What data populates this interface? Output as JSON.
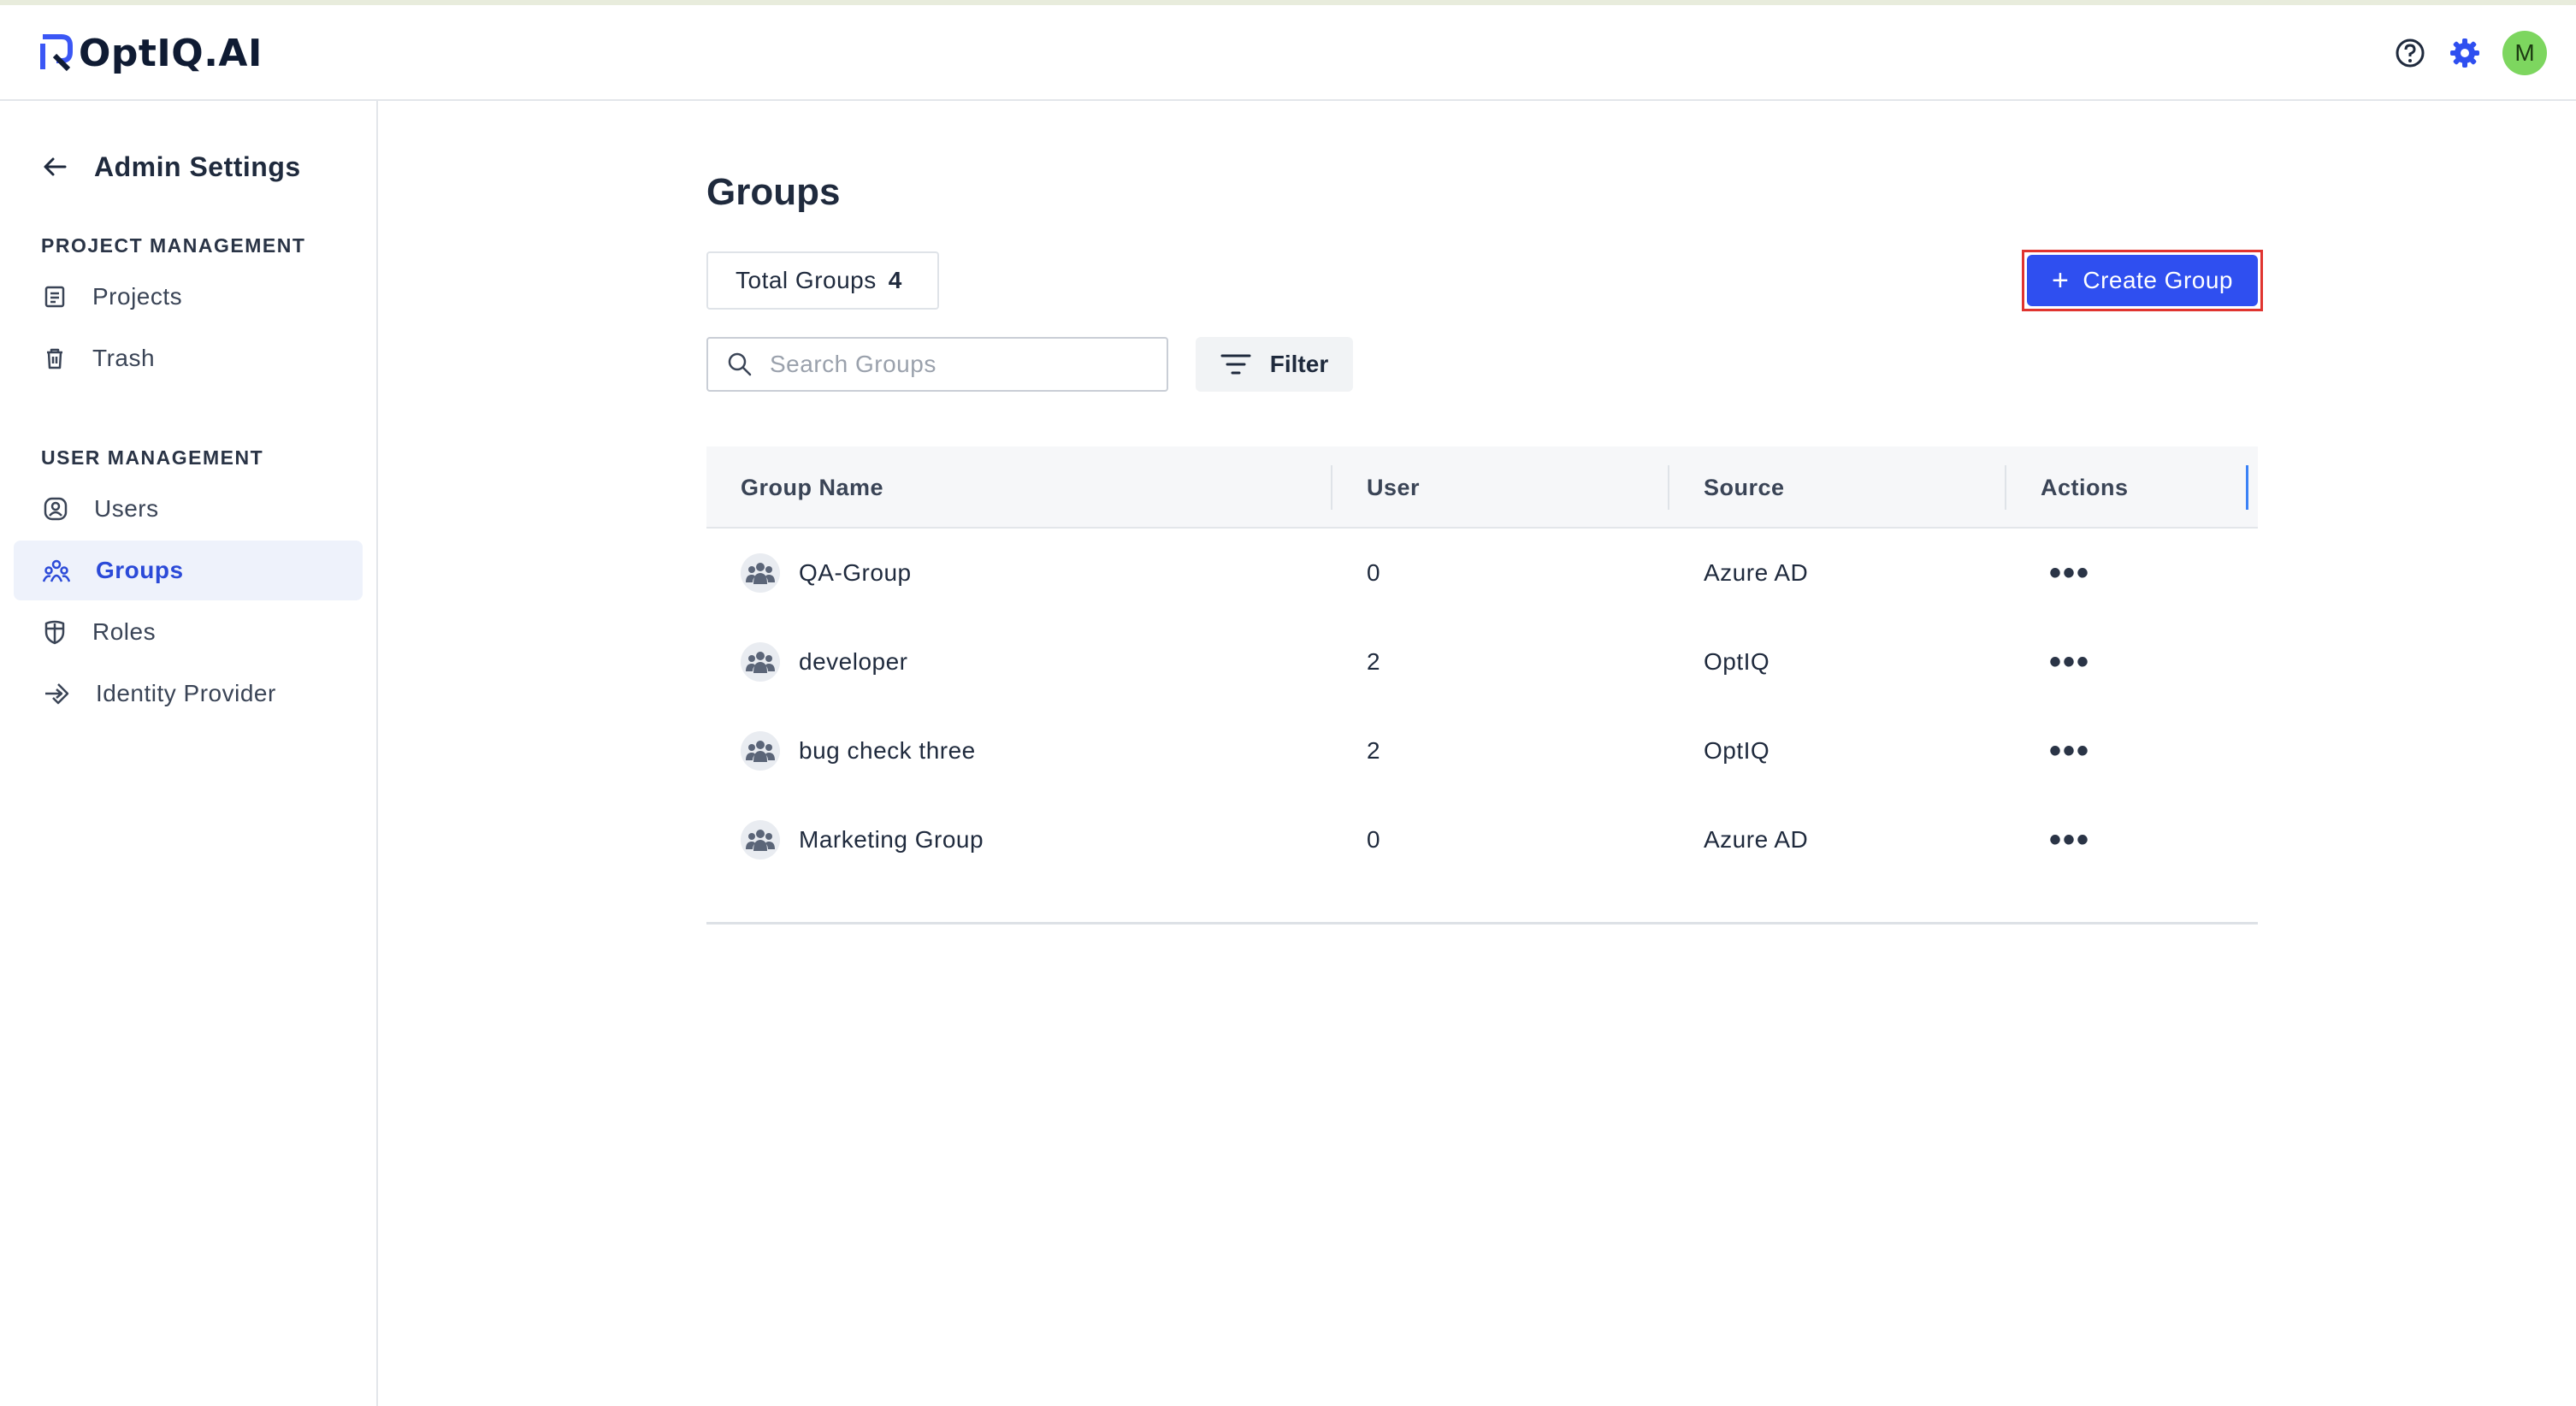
{
  "app": {
    "logo_text": "OptIQ.AI",
    "avatar_initial": "M",
    "avatar_color": "#7dd65f",
    "accent_color": "#2f4ff0"
  },
  "header_icons": [
    "help-icon",
    "gear-icon",
    "avatar"
  ],
  "sidebar": {
    "title": "Admin Settings",
    "sections": [
      {
        "title": "PROJECT MANAGEMENT",
        "items": [
          {
            "label": "Projects",
            "icon": "document-icon"
          },
          {
            "label": "Trash",
            "icon": "trash-icon"
          }
        ]
      },
      {
        "title": "USER MANAGEMENT",
        "items": [
          {
            "label": "Users",
            "icon": "user-icon"
          },
          {
            "label": "Groups",
            "icon": "group-icon",
            "active": true
          },
          {
            "label": "Roles",
            "icon": "shield-icon"
          },
          {
            "label": "Identity Provider",
            "icon": "login-icon"
          }
        ]
      }
    ]
  },
  "main": {
    "title": "Groups",
    "total_label": "Total Groups",
    "total_count": "4",
    "create_button": "Create Group",
    "search_placeholder": "Search Groups",
    "filter_label": "Filter",
    "table": {
      "headers": [
        "Group Name",
        "User",
        "Source",
        "Actions"
      ],
      "rows": [
        {
          "name": "QA-Group",
          "users": "0",
          "source": "Azure AD"
        },
        {
          "name": "developer",
          "users": "2",
          "source": "OptIQ"
        },
        {
          "name": "bug check three",
          "users": "2",
          "source": "OptIQ"
        },
        {
          "name": "Marketing Group",
          "users": "0",
          "source": "Azure AD"
        }
      ]
    }
  }
}
